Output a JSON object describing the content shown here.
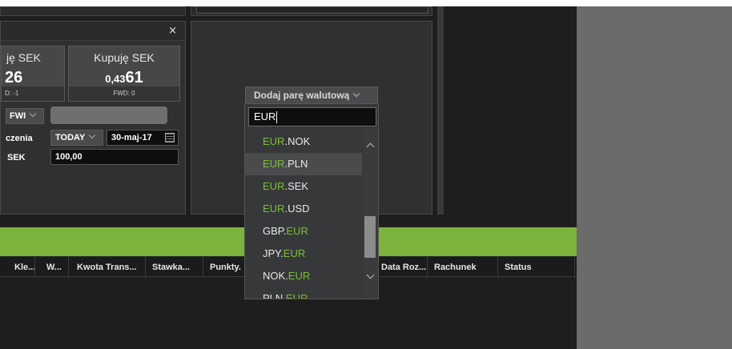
{
  "tile": {
    "close": "×",
    "sell": {
      "label": "ję SEK",
      "price": "26",
      "fwd": "D: -1"
    },
    "buy": {
      "label": "Kupuję SEK",
      "price_small": "0,43",
      "price_big": "61",
      "fwd_label": "FWD:",
      "fwd_value": "0"
    },
    "fwd_btn": "FWI",
    "settlement_label": "czenia",
    "today_btn": "TODAY",
    "date": "30-maj-17",
    "amount_label": "SEK",
    "amount": "100,00"
  },
  "dropdown": {
    "button_label": "Dodaj parę walutową",
    "search_value": "EUR",
    "items": [
      {
        "before": "",
        "match": "EUR",
        "after": ".NOK"
      },
      {
        "before": "",
        "match": "EUR",
        "after": ".PLN",
        "selected": true
      },
      {
        "before": "",
        "match": "EUR",
        "after": ".SEK"
      },
      {
        "before": "",
        "match": "EUR",
        "after": ".USD"
      },
      {
        "before": "GBP.",
        "match": "EUR",
        "after": ""
      },
      {
        "before": "JPY.",
        "match": "EUR",
        "after": ""
      },
      {
        "before": "NOK.",
        "match": "EUR",
        "after": ""
      },
      {
        "before": "PLN.",
        "match": "EUR",
        "after": ""
      }
    ]
  },
  "table": {
    "columns": [
      "Kle...",
      "W...",
      "Kwota Trans...",
      "Stawka...",
      "Punkty.",
      "Data Roz...",
      "Rachunek",
      "Status"
    ]
  },
  "colors": {
    "accent_green": "#7bb33d",
    "match_green": "#7bbf3a"
  }
}
